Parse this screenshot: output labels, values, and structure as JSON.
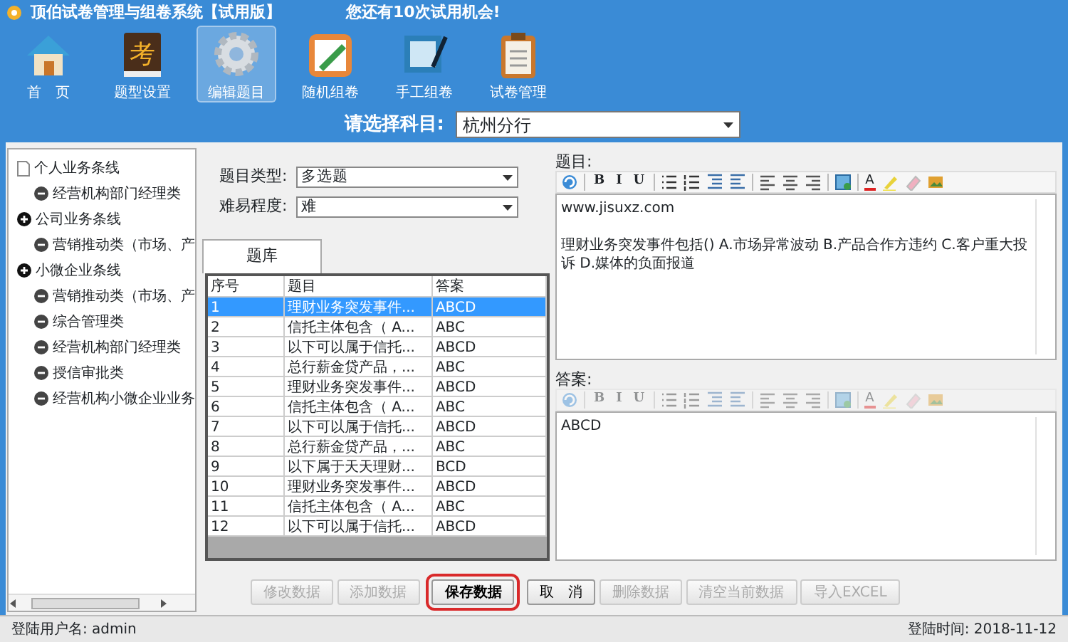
{
  "window": {
    "title": "顶伯试卷管理与组卷系统【试用版】",
    "notice": "您还有10次试用机会!"
  },
  "nav": [
    {
      "label": "首　页",
      "kind": "home",
      "selected": false
    },
    {
      "label": "题型设置",
      "kind": "book",
      "glyph": "考",
      "selected": false
    },
    {
      "label": "编辑题目",
      "kind": "gear",
      "selected": true
    },
    {
      "label": "随机组卷",
      "kind": "pencil",
      "selected": false
    },
    {
      "label": "手工组卷",
      "kind": "notebook",
      "selected": false
    },
    {
      "label": "试卷管理",
      "kind": "clipboard",
      "selected": false
    }
  ],
  "subject": {
    "label": "请选择科目:",
    "value": "杭州分行"
  },
  "tree": [
    {
      "label": "个人业务条线",
      "kind": "page",
      "children": [
        {
          "label": "经营机构部门经理类",
          "kind": "minus"
        }
      ]
    },
    {
      "label": "公司业务条线",
      "kind": "plus",
      "children": [
        {
          "label": "营销推动类（市场、产",
          "kind": "minus"
        }
      ]
    },
    {
      "label": "小微企业条线",
      "kind": "plus",
      "children": [
        {
          "label": "营销推动类（市场、产",
          "kind": "minus"
        },
        {
          "label": "综合管理类",
          "kind": "minus"
        },
        {
          "label": "经营机构部门经理类",
          "kind": "minus"
        },
        {
          "label": "授信审批类",
          "kind": "minus"
        },
        {
          "label": "经营机构小微企业业务",
          "kind": "minus"
        }
      ]
    }
  ],
  "filters": [
    {
      "label": "题目类型:",
      "value": "多选题"
    },
    {
      "label": "难易程度:",
      "value": "难"
    }
  ],
  "tab": {
    "label": "题库"
  },
  "table": {
    "columns": [
      "序号",
      "题目",
      "答案"
    ],
    "rows": [
      {
        "cells": [
          "1",
          "理财业务突发事件...",
          "ABCD"
        ],
        "selected": true
      },
      {
        "cells": [
          "2",
          "信托主体包含（ A...",
          "ABC"
        ],
        "selected": false
      },
      {
        "cells": [
          "3",
          "以下可以属于信托...",
          "ABCD"
        ],
        "selected": false
      },
      {
        "cells": [
          "4",
          "总行薪金贷产品，...",
          "ABC"
        ],
        "selected": false
      },
      {
        "cells": [
          "5",
          "理财业务突发事件...",
          "ABCD"
        ],
        "selected": false
      },
      {
        "cells": [
          "6",
          "信托主体包含（ A...",
          "ABC"
        ],
        "selected": false
      },
      {
        "cells": [
          "7",
          "以下可以属于信托...",
          "ABCD"
        ],
        "selected": false
      },
      {
        "cells": [
          "8",
          "总行薪金贷产品，...",
          "ABC"
        ],
        "selected": false
      },
      {
        "cells": [
          "9",
          "以下属于天天理财...",
          "BCD"
        ],
        "selected": false
      },
      {
        "cells": [
          "10",
          "理财业务突发事件...",
          "ABCD"
        ],
        "selected": false
      },
      {
        "cells": [
          "11",
          "信托主体包含（ A...",
          "ABC"
        ],
        "selected": false
      },
      {
        "cells": [
          "12",
          "以下可以属于信托...",
          "ABCD"
        ],
        "selected": false
      }
    ]
  },
  "editors": [
    {
      "label": "题目:",
      "disabled": false,
      "lines": [
        "www.jisuxz.com",
        "理财业务突发事件包括() A.市场异常波动  B.产品合作方违约  C.客户重大投诉  D.媒体的负面报道"
      ],
      "toolbar": [
        {
          "kind": "undo"
        },
        {
          "kind": "sep"
        },
        {
          "kind": "letter",
          "label": "B"
        },
        {
          "kind": "letter",
          "label": "I"
        },
        {
          "kind": "letter",
          "label": "U"
        },
        {
          "kind": "sep"
        },
        {
          "kind": "bullets"
        },
        {
          "kind": "numbers"
        },
        {
          "kind": "indent"
        },
        {
          "kind": "outdent"
        },
        {
          "kind": "sep"
        },
        {
          "kind": "alignleft"
        },
        {
          "kind": "aligncenter"
        },
        {
          "kind": "alignright"
        },
        {
          "kind": "sep"
        },
        {
          "kind": "image"
        },
        {
          "kind": "sep"
        },
        {
          "kind": "fontcolor",
          "label": "A"
        },
        {
          "kind": "highlight"
        },
        {
          "kind": "eraser"
        },
        {
          "kind": "picture"
        }
      ]
    },
    {
      "label": "答案:",
      "disabled": true,
      "lines": [
        "ABCD"
      ],
      "toolbar": [
        {
          "kind": "undo"
        },
        {
          "kind": "sep"
        },
        {
          "kind": "letter",
          "label": "B"
        },
        {
          "kind": "letter",
          "label": "I"
        },
        {
          "kind": "letter",
          "label": "U"
        },
        {
          "kind": "sep"
        },
        {
          "kind": "bullets"
        },
        {
          "kind": "numbers"
        },
        {
          "kind": "indent"
        },
        {
          "kind": "outdent"
        },
        {
          "kind": "sep"
        },
        {
          "kind": "alignleft"
        },
        {
          "kind": "aligncenter"
        },
        {
          "kind": "alignright"
        },
        {
          "kind": "sep"
        },
        {
          "kind": "image"
        },
        {
          "kind": "sep"
        },
        {
          "kind": "fontcolor",
          "label": "A"
        },
        {
          "kind": "highlight"
        },
        {
          "kind": "eraser"
        },
        {
          "kind": "picture"
        }
      ]
    }
  ],
  "buttons": [
    {
      "label": "修改数据",
      "disabled": true,
      "highlighted": false
    },
    {
      "label": "添加数据",
      "disabled": true,
      "highlighted": false
    },
    {
      "label": "保存数据",
      "disabled": false,
      "highlighted": true
    },
    {
      "label": "取　消",
      "disabled": false,
      "highlighted": false
    },
    {
      "label": "删除数据",
      "disabled": true,
      "highlighted": false
    },
    {
      "label": "清空当前数据",
      "disabled": true,
      "highlighted": false
    },
    {
      "label": "导入EXCEL",
      "disabled": true,
      "highlighted": false
    }
  ],
  "status_bar": {
    "user": "登陆用户名: admin",
    "time": "登陆时间: 2018-11-12"
  }
}
